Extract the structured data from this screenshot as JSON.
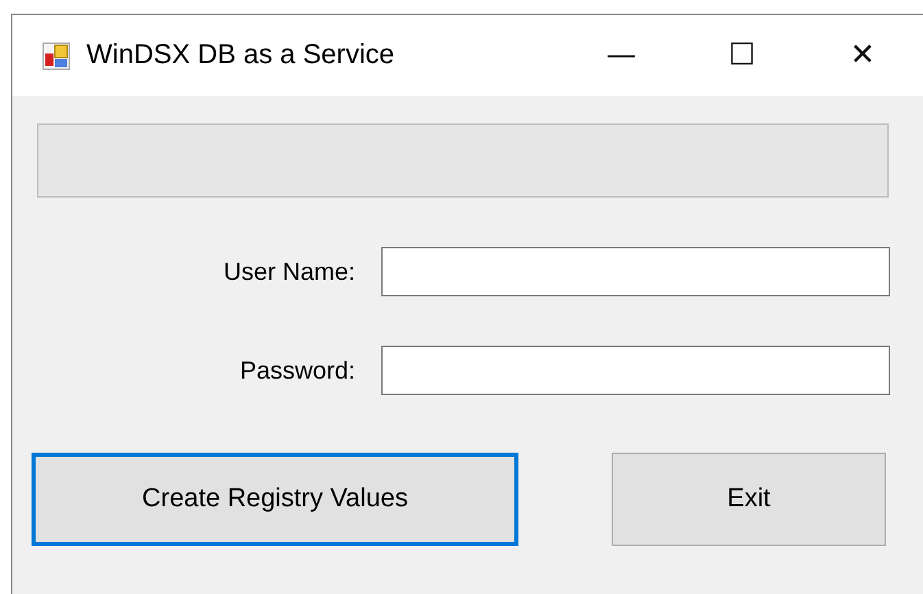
{
  "window": {
    "title": "WinDSX DB as a Service",
    "controls": [
      "—",
      "☐",
      "✕"
    ]
  },
  "fields": [
    {
      "label": "User Name:"
    },
    {
      "label": "Password:"
    }
  ],
  "buttons": [
    {
      "label": "Create Registry Values",
      "focused": true
    },
    {
      "label": "Exit",
      "focused": false
    }
  ]
}
